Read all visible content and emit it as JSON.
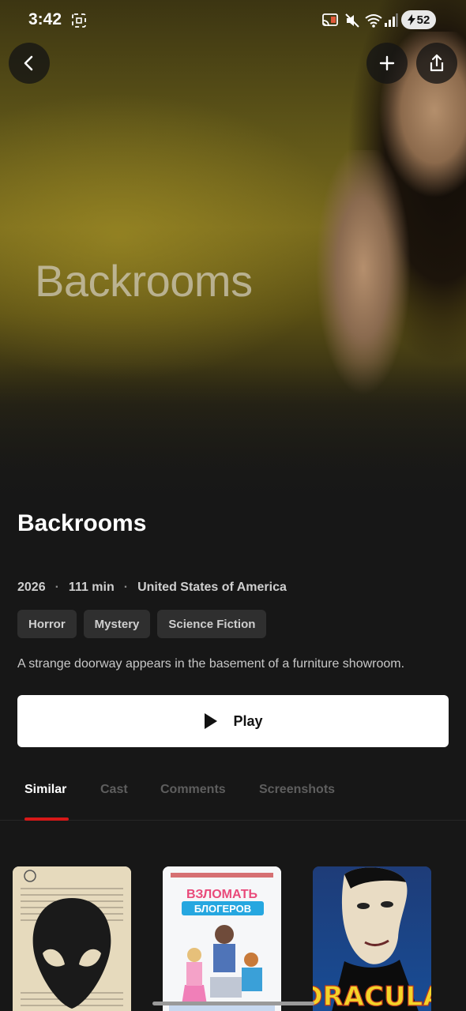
{
  "status_bar": {
    "time": "3:42",
    "battery": "52"
  },
  "hero": {
    "logo_text": "Backrooms"
  },
  "movie": {
    "title": "Backrooms",
    "year": "2026",
    "runtime": "111 min",
    "country": "United States of America",
    "genres": [
      "Horror",
      "Mystery",
      "Science Fiction"
    ],
    "overview": "A strange doorway appears in the basement of a furniture showroom."
  },
  "actions": {
    "play_label": "Play"
  },
  "tabs": [
    {
      "label": "Similar",
      "active": true
    },
    {
      "label": "Cast",
      "active": false
    },
    {
      "label": "Comments",
      "active": false
    },
    {
      "label": "Screenshots",
      "active": false
    }
  ],
  "similar": {
    "posters": [
      {
        "title": ""
      },
      {
        "title": "ВЗЛОМАТЬ БЛОГЕРОВ"
      },
      {
        "title": "DRACULA"
      }
    ]
  },
  "colors": {
    "background": "#171717",
    "accent": "#d71818",
    "chip_bg": "#2f2f2f",
    "play_bg": "#ffffff"
  },
  "icons": {
    "back": "chevron-left-icon",
    "add": "plus-icon",
    "share": "share-icon",
    "play": "play-icon"
  }
}
